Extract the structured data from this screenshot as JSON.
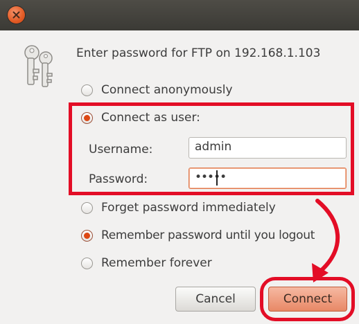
{
  "dialog": {
    "prompt": "Enter password for FTP on 192.168.1.103"
  },
  "options": {
    "connect_anonymously": {
      "label": "Connect anonymously",
      "selected": false
    },
    "connect_as_user": {
      "label": "Connect as user:",
      "selected": true
    }
  },
  "fields": {
    "username_label": "Username:",
    "username_value": "admin",
    "password_label": "Password:",
    "password_value": "•••••"
  },
  "remember": {
    "forget": {
      "label": "Forget password immediately",
      "selected": false
    },
    "until_logout": {
      "label": "Remember password until you logout",
      "selected": true
    },
    "forever": {
      "label": "Remember forever",
      "selected": false
    }
  },
  "buttons": {
    "cancel": "Cancel",
    "connect": "Connect"
  },
  "colors": {
    "accent": "#dd4814",
    "annotation": "#e30d26",
    "titlebar": "#3c3b37"
  },
  "icons": {
    "close": "close-icon",
    "keys": "keys-icon"
  }
}
